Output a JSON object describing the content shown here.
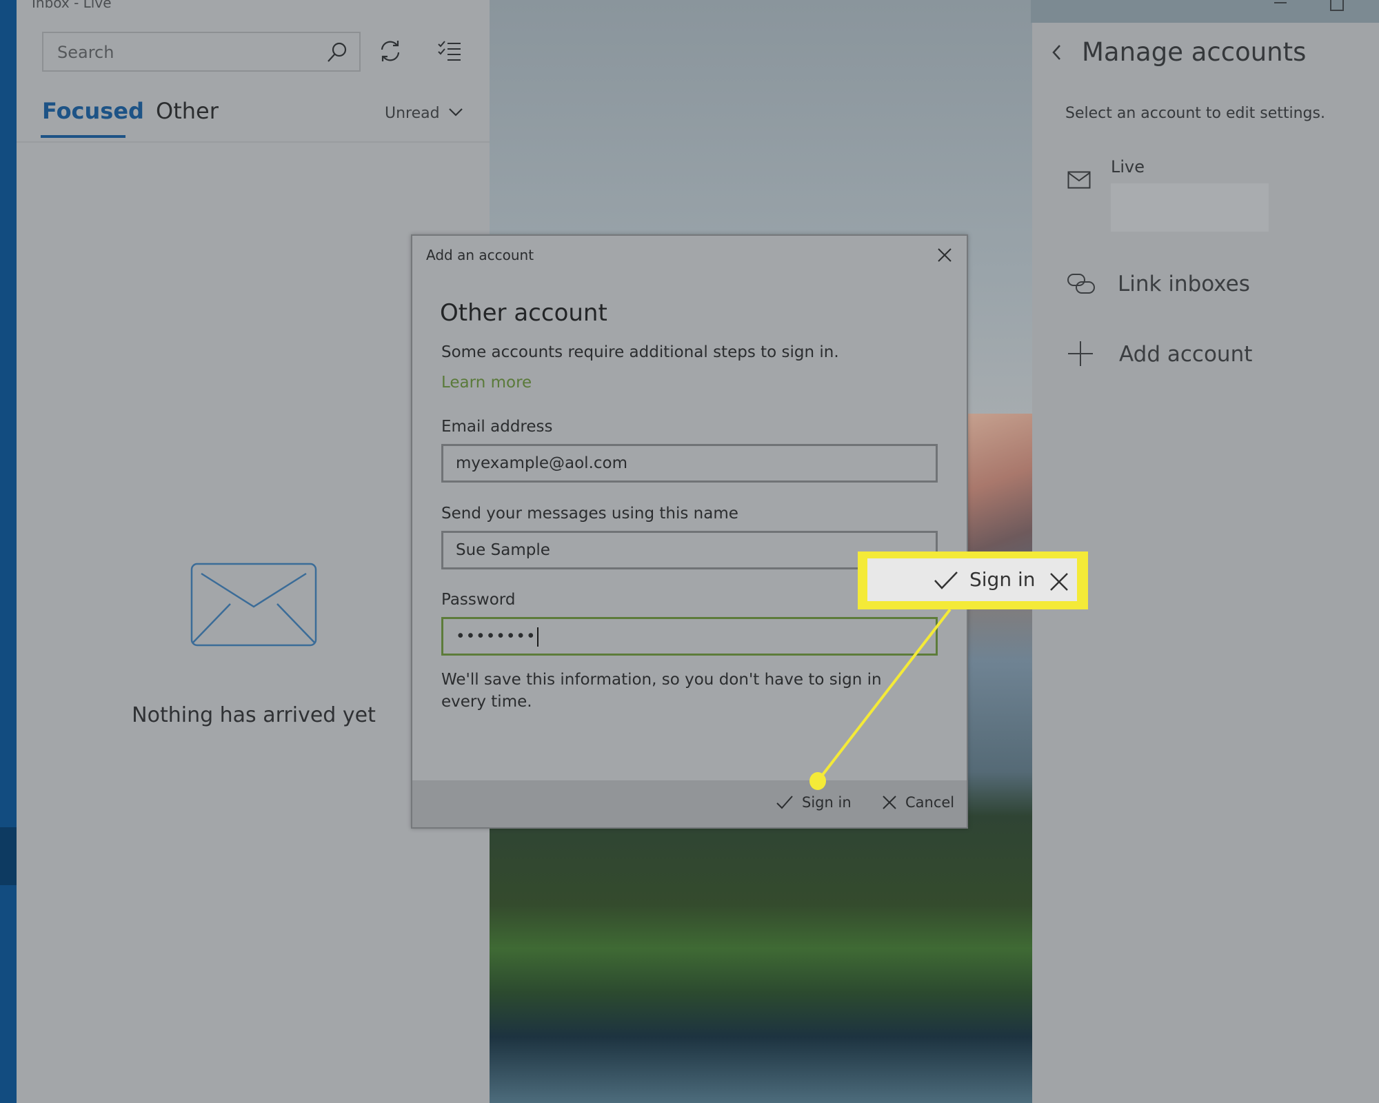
{
  "window": {
    "title": "Inbox - Live"
  },
  "inbox": {
    "search_placeholder": "Search",
    "tabs": [
      {
        "label": "Focused",
        "selected": true
      },
      {
        "label": "Other",
        "selected": false
      }
    ],
    "filter": "Unread",
    "empty_message": "Nothing has arrived yet",
    "icons": [
      "search-icon",
      "refresh-icon",
      "select-mode-icon",
      "chevron-down-icon",
      "empty-mail-icon"
    ]
  },
  "manage_accounts": {
    "title": "Manage accounts",
    "subtitle": "Select an account to edit settings.",
    "accounts": [
      {
        "name": "Live",
        "icon": "mail-icon"
      }
    ],
    "actions": [
      {
        "label": "Link inboxes",
        "icon": "link-icon"
      },
      {
        "label": "Add account",
        "icon": "plus-icon"
      }
    ]
  },
  "dialog": {
    "title": "Add an account",
    "heading": "Other account",
    "description": "Some accounts require additional steps to sign in.",
    "learn_more": "Learn more",
    "email_label": "Email address",
    "email_value": "myexample@aol.com",
    "name_label": "Send your messages using this name",
    "name_value": "Sue Sample",
    "password_label": "Password",
    "password_masked": "••••••••",
    "save_note": "We'll save this information, so you don't have to sign in every time.",
    "sign_in": "Sign in",
    "cancel": "Cancel"
  },
  "callout": {
    "label": "Sign in",
    "color": "#f4ea38"
  },
  "colors": {
    "accent": "#1d5386",
    "nav_bar": "#124c80",
    "learn_more": "#5a7a3a",
    "password_focus": "#5d7c3a"
  }
}
